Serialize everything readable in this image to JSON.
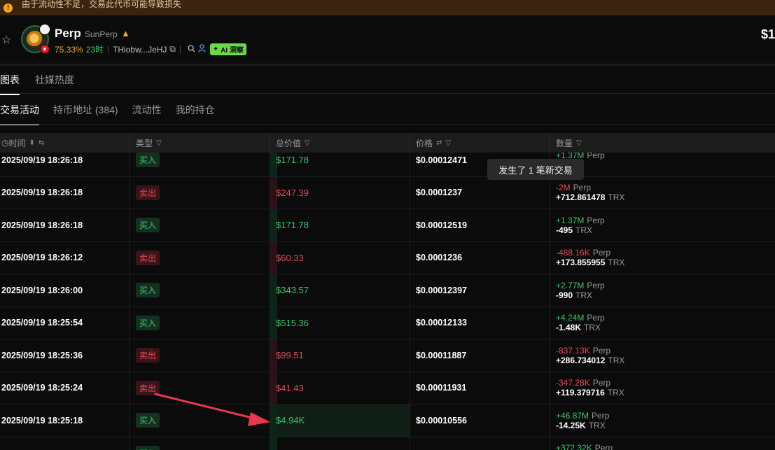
{
  "banner": {
    "icon": "warning-icon",
    "text": "由于流动性不足，交易此代币可能导致损失"
  },
  "token": {
    "name": "Perp",
    "fullname": "SunPerp",
    "change": "75.33%",
    "age": "23时",
    "address": "THiobw...JeHJ",
    "ai_label": "AI 洞察",
    "price_partial": "$1"
  },
  "tabs_top": [
    "图表",
    "社媒热度"
  ],
  "tabs_sub": [
    "交易活动",
    "持币地址 (384)",
    "流动性",
    "我的持仓"
  ],
  "table": {
    "headers": {
      "time": "时间",
      "type": "类型",
      "total": "总价值",
      "price": "价格",
      "amount": "数量"
    },
    "rows": [
      {
        "time": "2025/09/19 18:26:18",
        "type": "买入",
        "side": "buy",
        "total": "$171.78",
        "price": "$0.00012471",
        "amount": "+1.37M",
        "amount_unit": "Perp",
        "trx": "",
        "trx_unit": "TRX"
      },
      {
        "time": "2025/09/19 18:26:18",
        "type": "卖出",
        "side": "sell",
        "total": "$247.39",
        "price": "$0.0001237",
        "amount": "-2M",
        "amount_unit": "Perp",
        "trx": "+712.861478",
        "trx_unit": "TRX"
      },
      {
        "time": "2025/09/19 18:26:18",
        "type": "买入",
        "side": "buy",
        "total": "$171.78",
        "price": "$0.00012519",
        "amount": "+1.37M",
        "amount_unit": "Perp",
        "trx": "-495",
        "trx_unit": "TRX"
      },
      {
        "time": "2025/09/19 18:26:12",
        "type": "卖出",
        "side": "sell",
        "total": "$60.33",
        "price": "$0.0001236",
        "amount": "-488.16K",
        "amount_unit": "Perp",
        "trx": "+173.855955",
        "trx_unit": "TRX"
      },
      {
        "time": "2025/09/19 18:26:00",
        "type": "买入",
        "side": "buy",
        "total": "$343.57",
        "price": "$0.00012397",
        "amount": "+2.77M",
        "amount_unit": "Perp",
        "trx": "-990",
        "trx_unit": "TRX"
      },
      {
        "time": "2025/09/19 18:25:54",
        "type": "买入",
        "side": "buy",
        "total": "$515.36",
        "price": "$0.00012133",
        "amount": "+4.24M",
        "amount_unit": "Perp",
        "trx": "-1.48K",
        "trx_unit": "TRX"
      },
      {
        "time": "2025/09/19 18:25:36",
        "type": "卖出",
        "side": "sell",
        "total": "$99.51",
        "price": "$0.00011887",
        "amount": "-837.13K",
        "amount_unit": "Perp",
        "trx": "+286.734012",
        "trx_unit": "TRX"
      },
      {
        "time": "2025/09/19 18:25:24",
        "type": "卖出",
        "side": "sell",
        "total": "$41.43",
        "price": "$0.00011931",
        "amount": "-347.28K",
        "amount_unit": "Perp",
        "trx": "+119.379716",
        "trx_unit": "TRX"
      },
      {
        "time": "2025/09/19 18:25:18",
        "type": "买入",
        "side": "buy",
        "total": "$4.94K",
        "price": "$0.00010556",
        "amount": "+46.87M",
        "amount_unit": "Perp",
        "trx": "-14.25K",
        "trx_unit": "TRX",
        "highlight": true
      },
      {
        "time": "",
        "type": "买入",
        "side": "buy",
        "total": "",
        "price": "",
        "amount": "+372.32K",
        "amount_unit": "Perp",
        "trx": "",
        "trx_unit": ""
      }
    ]
  },
  "toast": "发生了 1 笔新交易",
  "colors": {
    "buy": "#3ec46d",
    "sell": "#e04b5a",
    "annotation_arrow": "#e8384f"
  }
}
